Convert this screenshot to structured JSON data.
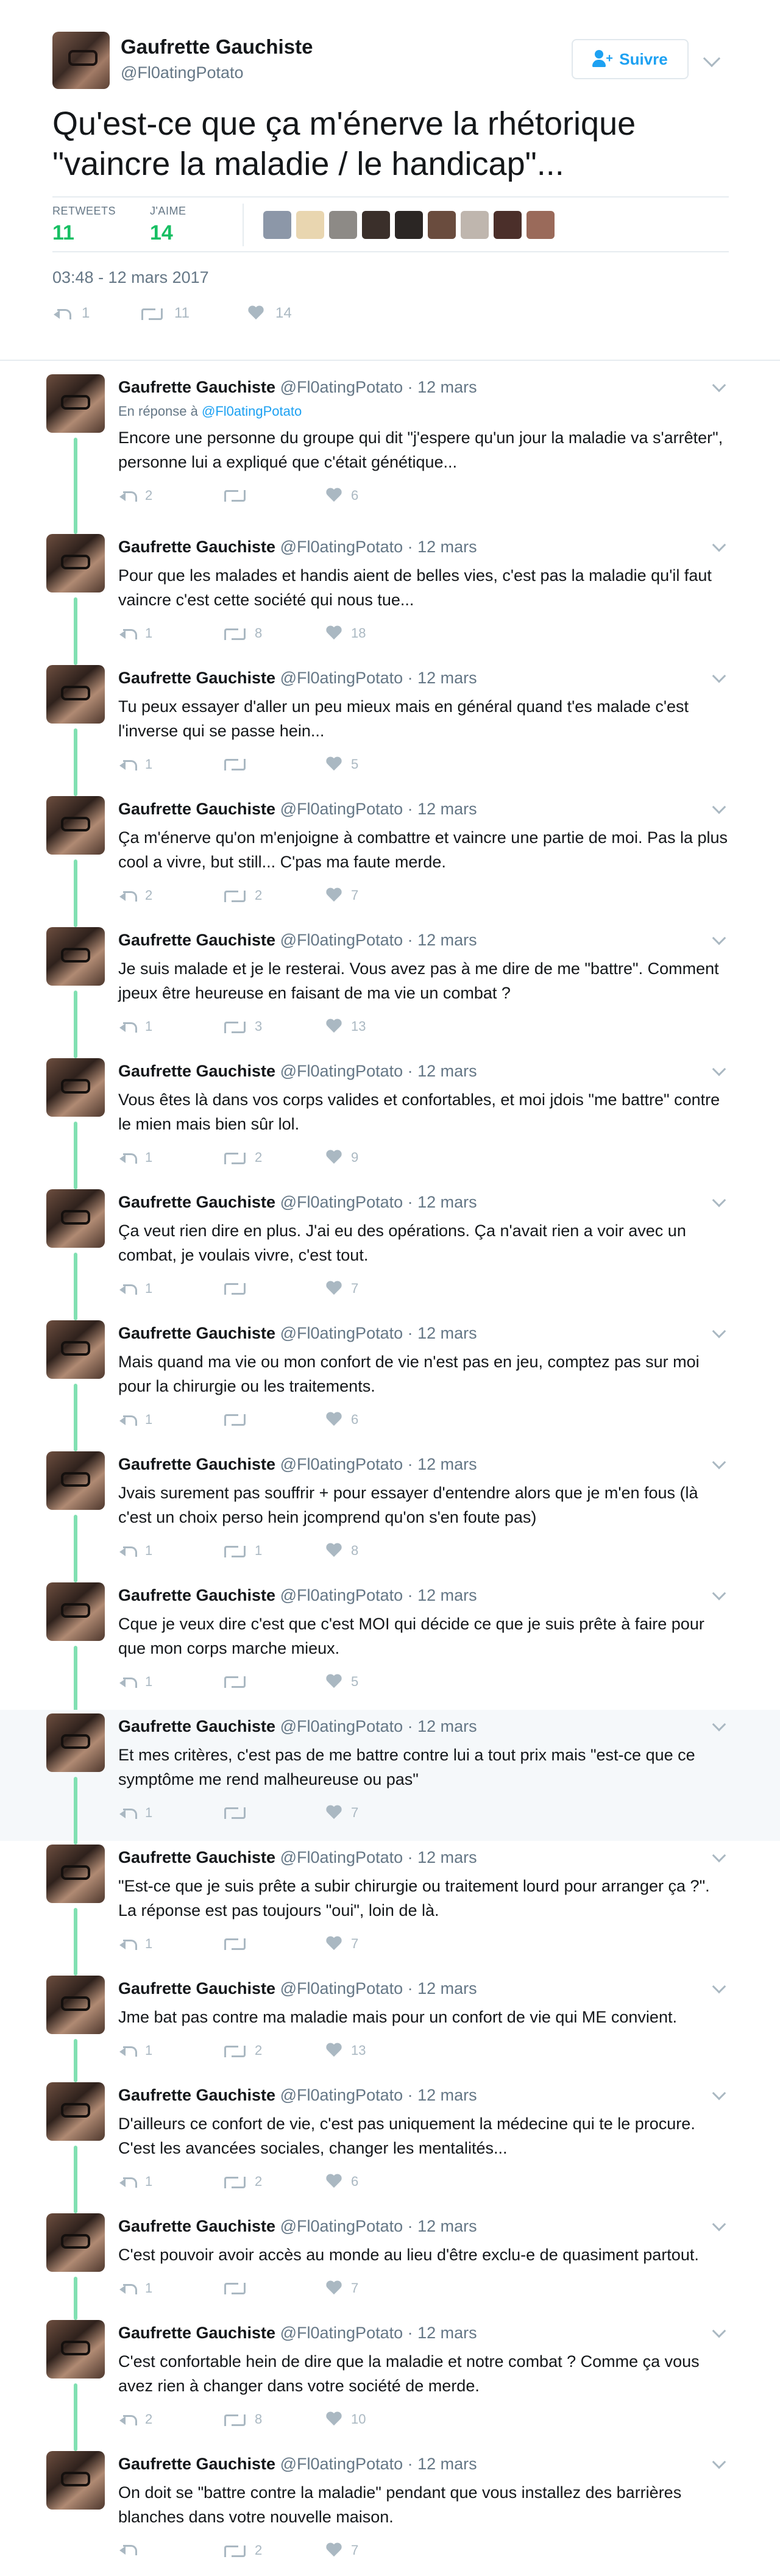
{
  "main_tweet": {
    "author_name": "Gaufrette Gauchiste",
    "author_handle": "@Fl0atingPotato",
    "follow_label": "Suivre",
    "text": "Qu'est-ce que ça m'énerve la rhétorique \"vaincre la maladie / le handicap\"...",
    "retweets_label": "RETWEETS",
    "retweets_count": "11",
    "likes_label": "J'AIME",
    "likes_count": "14",
    "timestamp": "03:48 - 12 mars 2017",
    "replies": "1",
    "retweets": "11",
    "likes": "14",
    "liker_colors": [
      "#8c97a8",
      "#e9d6b0",
      "#8d8a86",
      "#3a2f2a",
      "#2b2624",
      "#6a4c3e",
      "#bfb6ae",
      "#4b2f2a",
      "#9a6a5a"
    ]
  },
  "colors": {
    "accent": "#1da1f2",
    "thread": "#81e0b2",
    "stat_green": "#17bf63",
    "muted": "#657786"
  },
  "replies": [
    {
      "name": "Gaufrette Gauchiste",
      "handle": "@Fl0atingPotato",
      "date": "· 12 mars",
      "in_reply_prefix": "En réponse à ",
      "in_reply_handle": "@Fl0atingPotato",
      "text": "Encore une personne du groupe qui dit \"j'espere qu'un jour la maladie va s'arrêter\", personne lui a expliqué que c'était génétique...",
      "replies": "2",
      "retweets": "",
      "likes": "6"
    },
    {
      "name": "Gaufrette Gauchiste",
      "handle": "@Fl0atingPotato",
      "date": "· 12 mars",
      "text": "Pour que les malades et handis aient de belles vies, c'est pas la maladie qu'il faut vaincre c'est cette société qui nous tue...",
      "replies": "1",
      "retweets": "8",
      "likes": "18"
    },
    {
      "name": "Gaufrette Gauchiste",
      "handle": "@Fl0atingPotato",
      "date": "· 12 mars",
      "text": "Tu peux essayer d'aller un peu mieux mais en général quand t'es malade c'est l'inverse qui se passe hein...",
      "replies": "1",
      "retweets": "",
      "likes": "5"
    },
    {
      "name": "Gaufrette Gauchiste",
      "handle": "@Fl0atingPotato",
      "date": "· 12 mars",
      "text": "Ça m'énerve qu'on m'enjoigne à combattre et vaincre une partie de moi. Pas la plus cool a vivre, but still... C'pas ma faute merde.",
      "replies": "2",
      "retweets": "2",
      "likes": "7"
    },
    {
      "name": "Gaufrette Gauchiste",
      "handle": "@Fl0atingPotato",
      "date": "· 12 mars",
      "text": "Je suis malade et je le resterai. Vous avez pas à me dire de me \"battre\". Comment jpeux être heureuse en faisant de ma vie un combat ?",
      "replies": "1",
      "retweets": "3",
      "likes": "13"
    },
    {
      "name": "Gaufrette Gauchiste",
      "handle": "@Fl0atingPotato",
      "date": "· 12 mars",
      "text": "Vous êtes là dans vos corps valides et confortables, et moi jdois \"me battre\" contre le mien mais bien sûr lol.",
      "replies": "1",
      "retweets": "2",
      "likes": "9"
    },
    {
      "name": "Gaufrette Gauchiste",
      "handle": "@Fl0atingPotato",
      "date": "· 12 mars",
      "text": "Ça veut rien dire en plus. J'ai eu des opérations. Ça n'avait rien a voir avec un combat, je voulais vivre, c'est tout.",
      "replies": "1",
      "retweets": "",
      "likes": "7"
    },
    {
      "name": "Gaufrette Gauchiste",
      "handle": "@Fl0atingPotato",
      "date": "· 12 mars",
      "text": "Mais quand ma vie ou mon confort de vie n'est pas en jeu, comptez pas sur moi pour la chirurgie ou les traitements.",
      "replies": "1",
      "retweets": "",
      "likes": "6"
    },
    {
      "name": "Gaufrette Gauchiste",
      "handle": "@Fl0atingPotato",
      "date": "· 12 mars",
      "text": "Jvais surement pas souffrir + pour essayer d'entendre alors que je m'en fous (là c'est un choix perso hein jcomprend qu'on s'en foute pas)",
      "replies": "1",
      "retweets": "1",
      "likes": "8"
    },
    {
      "name": "Gaufrette Gauchiste",
      "handle": "@Fl0atingPotato",
      "date": "· 12 mars",
      "text": "Cque je veux dire c'est que c'est MOI qui décide ce que je suis prête à faire pour que mon corps marche mieux.",
      "replies": "1",
      "retweets": "",
      "likes": "5"
    },
    {
      "name": "Gaufrette Gauchiste",
      "handle": "@Fl0atingPotato",
      "date": "· 12 mars",
      "text": "Et mes critères, c'est pas de me battre contre lui a tout prix mais \"est-ce que ce symptôme me rend malheureuse ou pas\"",
      "replies": "1",
      "retweets": "",
      "likes": "7"
    },
    {
      "name": "Gaufrette Gauchiste",
      "handle": "@Fl0atingPotato",
      "date": "· 12 mars",
      "text": "\"Est-ce que je suis prête a subir chirurgie ou traitement lourd pour arranger ça ?\". La réponse est pas toujours \"oui\", loin de là.",
      "replies": "1",
      "retweets": "",
      "likes": "7"
    },
    {
      "name": "Gaufrette Gauchiste",
      "handle": "@Fl0atingPotato",
      "date": "· 12 mars",
      "text": "Jme bat pas contre ma maladie mais pour un confort de vie qui ME convient.",
      "replies": "1",
      "retweets": "2",
      "likes": "13"
    },
    {
      "name": "Gaufrette Gauchiste",
      "handle": "@Fl0atingPotato",
      "date": "· 12 mars",
      "text": "D'ailleurs ce confort de vie, c'est pas uniquement la médecine qui te le procure. C'est les avancées sociales, changer les mentalités...",
      "replies": "1",
      "retweets": "2",
      "likes": "6"
    },
    {
      "name": "Gaufrette Gauchiste",
      "handle": "@Fl0atingPotato",
      "date": "· 12 mars",
      "text": "C'est pouvoir avoir accès au monde au lieu d'être exclu-e de quasiment partout.",
      "replies": "1",
      "retweets": "",
      "likes": "7"
    },
    {
      "name": "Gaufrette Gauchiste",
      "handle": "@Fl0atingPotato",
      "date": "· 12 mars",
      "text": "C'est confortable hein de dire que la maladie et notre combat ? Comme ça vous avez rien à changer dans votre société de merde.",
      "replies": "2",
      "retweets": "8",
      "likes": "10"
    },
    {
      "name": "Gaufrette Gauchiste",
      "handle": "@Fl0atingPotato",
      "date": "· 12 mars",
      "text": "On doit se \"battre contre la maladie\" pendant que vous installez des barrières blanches dans votre nouvelle maison.",
      "replies": "",
      "retweets": "2",
      "likes": "7"
    }
  ]
}
